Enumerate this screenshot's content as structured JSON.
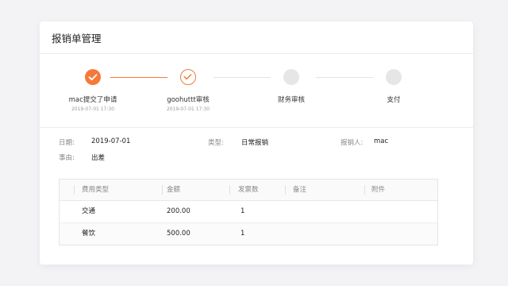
{
  "header": {
    "title": "报销单管理"
  },
  "steps": [
    {
      "title": "mac提交了申请",
      "time": "2019-07-01 17:30",
      "state": "done",
      "icon": "check-icon"
    },
    {
      "title": "goohuttt审核",
      "time": "2019-07-01 17:30",
      "state": "current",
      "icon": "check-icon"
    },
    {
      "title": "财务审核",
      "time": "",
      "state": "pending",
      "icon": ""
    },
    {
      "title": "支付",
      "time": "",
      "state": "pending",
      "icon": ""
    }
  ],
  "info": {
    "date_label": "日期:",
    "date_value": "2019-07-01",
    "type_label": "类型:",
    "type_value": "日常报销",
    "applicant_label": "报销人:",
    "applicant_value": "mac",
    "reason_label": "事由:",
    "reason_value": "出差"
  },
  "table": {
    "columns": [
      "费用类型",
      "金额",
      "发票数",
      "备注",
      "附件"
    ],
    "rows": [
      [
        "交通",
        "200.00",
        "1",
        "",
        ""
      ],
      [
        "餐饮",
        "500.00",
        "1",
        "",
        ""
      ]
    ]
  },
  "colors": {
    "accent": "#f5793a",
    "pending": "#e6e6e6",
    "background": "#f3f3f5"
  }
}
